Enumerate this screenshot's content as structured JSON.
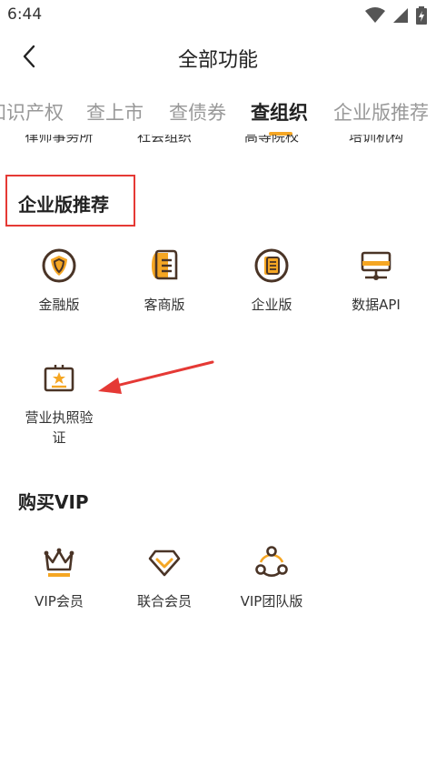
{
  "status_bar": {
    "time": "6:44",
    "icons": [
      "wifi-icon",
      "signal-icon",
      "battery-icon"
    ]
  },
  "header": {
    "title": "全部功能",
    "back_icon": "chevron-left-icon"
  },
  "tabs": [
    {
      "label": "知识产权",
      "active": false
    },
    {
      "label": "查上市",
      "active": false
    },
    {
      "label": "查债券",
      "active": false
    },
    {
      "label": "查组织",
      "active": true
    },
    {
      "label": "企业版推荐",
      "active": false
    }
  ],
  "clipped_row": [
    "律师事务所",
    "社会组织",
    "高等院校",
    "培训机构"
  ],
  "enterprise": {
    "title": "企业版推荐",
    "items": [
      {
        "label": "金融版",
        "icon": "finance-shield-icon"
      },
      {
        "label": "客商版",
        "icon": "merchant-document-icon"
      },
      {
        "label": "企业版",
        "icon": "enterprise-shield-icon"
      },
      {
        "label": "数据API",
        "icon": "data-server-icon"
      },
      {
        "label": "营业执照验证",
        "icon": "license-star-icon"
      }
    ]
  },
  "vip": {
    "title": "购买VIP",
    "items": [
      {
        "label": "VIP会员",
        "icon": "crown-icon"
      },
      {
        "label": "联合会员",
        "icon": "diamond-icon"
      },
      {
        "label": "VIP团队版",
        "icon": "team-nodes-icon"
      }
    ]
  },
  "colors": {
    "accent": "#f5a623",
    "icon_dark": "#4a3426",
    "annotation_red": "#e53935"
  }
}
